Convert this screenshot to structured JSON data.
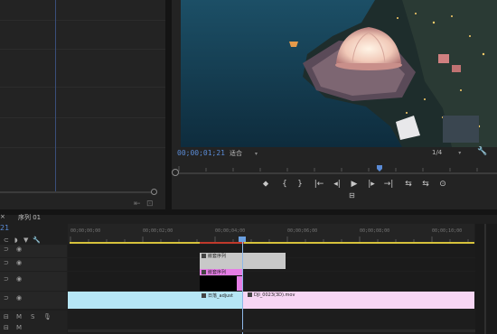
{
  "source_monitor": {
    "buttons": [
      "⇤",
      "⊡"
    ]
  },
  "program_monitor": {
    "timecode": "00;00;01;21",
    "fit_value": "适合",
    "quality_value": "1/4",
    "transport": [
      "⬥",
      "{",
      "}",
      "|←",
      "◂|",
      "▶",
      "|▸",
      "→|",
      "⇆",
      "⇆",
      "⊙"
    ],
    "export_frame": "⊟"
  },
  "timeline": {
    "sequence_tab": "× ",
    "sequence_name": "序列 01",
    "timecode": "21",
    "ruler_ticks": [
      "00;00;00;00",
      "00;00;02;00",
      "00;00;04;00",
      "00;00;06;00",
      "00;00;08;00",
      "00;00;10;00"
    ],
    "tracks": [
      {
        "id": "V3"
      },
      {
        "id": "V2"
      },
      {
        "id": "V1"
      },
      {
        "id": "A1"
      }
    ],
    "clips": {
      "v3_label": "嵌套序列",
      "v2_label": "嵌套序列",
      "v1_a_label": "日落_adjust",
      "v1_b_label": "DJI_0023(3D).mov"
    },
    "colors": {
      "accent_blue": "#5a8bd6",
      "clip_magenta": "#e67ee6",
      "clip_pink": "#f7d6f4",
      "clip_cyan": "#b6e6f5",
      "clip_gray": "#c8c8c8"
    }
  },
  "icons": [
    "wrench-icon",
    "eye-icon",
    "lock-icon",
    "marker-icon",
    "play-icon",
    "camera-icon"
  ]
}
